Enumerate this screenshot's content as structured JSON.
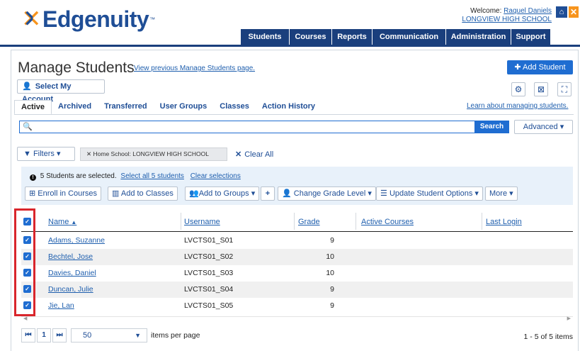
{
  "header": {
    "logo_text": "Edgenuity",
    "logo_tm": "™",
    "welcome_label": "Welcome:",
    "user_name": "Raquel Daniels",
    "school_name": "LONGVIEW HIGH SCHOOL",
    "nav": [
      "Students",
      "Courses",
      "Reports",
      "Communication",
      "Administration",
      "Support"
    ]
  },
  "page": {
    "title": "Manage Students",
    "prev_link": "View previous Manage Students page.",
    "add_student": "Add Student",
    "select_account": "Select My Account",
    "learn_link": "Learn about managing students."
  },
  "tabs": [
    "Active",
    "Archived",
    "Transferred",
    "User Groups",
    "Classes",
    "Action History"
  ],
  "search": {
    "placeholder": "",
    "button": "Search",
    "advanced": "Advanced"
  },
  "filters": {
    "button": "Filters",
    "chip": "Home School: LONGVIEW HIGH SCHOOL",
    "clear_all": "Clear All"
  },
  "selection": {
    "info": "5 Students are selected.",
    "select_all": "Select all 5 students",
    "clear": "Clear selections",
    "actions": [
      "Enroll in Courses",
      "Add to Classes",
      "Add to Groups",
      "Change Grade Level",
      "Update Student Options",
      "More"
    ]
  },
  "table": {
    "columns": [
      "Name",
      "Username",
      "Grade",
      "Active Courses",
      "Last Login"
    ],
    "rows": [
      {
        "name": "Adams, Suzanne",
        "username": "LVCTS01_S01",
        "grade": "9",
        "checked": true
      },
      {
        "name": "Bechtel, Jose",
        "username": "LVCTS01_S02",
        "grade": "10",
        "checked": true
      },
      {
        "name": "Davies, Daniel",
        "username": "LVCTS01_S03",
        "grade": "10",
        "checked": true
      },
      {
        "name": "Duncan, Julie",
        "username": "LVCTS01_S04",
        "grade": "9",
        "checked": true
      },
      {
        "name": "Jie, Lan",
        "username": "LVCTS01_S05",
        "grade": "9",
        "checked": true
      }
    ]
  },
  "pager": {
    "page": "1",
    "per_page": "50",
    "per_page_label": "items per page",
    "count": "1 - 5 of 5 items"
  },
  "colors": {
    "brand_blue": "#1f4e96",
    "brand_orange": "#f7941d",
    "accent": "#1f6dd1",
    "highlight": "#d9262c"
  }
}
